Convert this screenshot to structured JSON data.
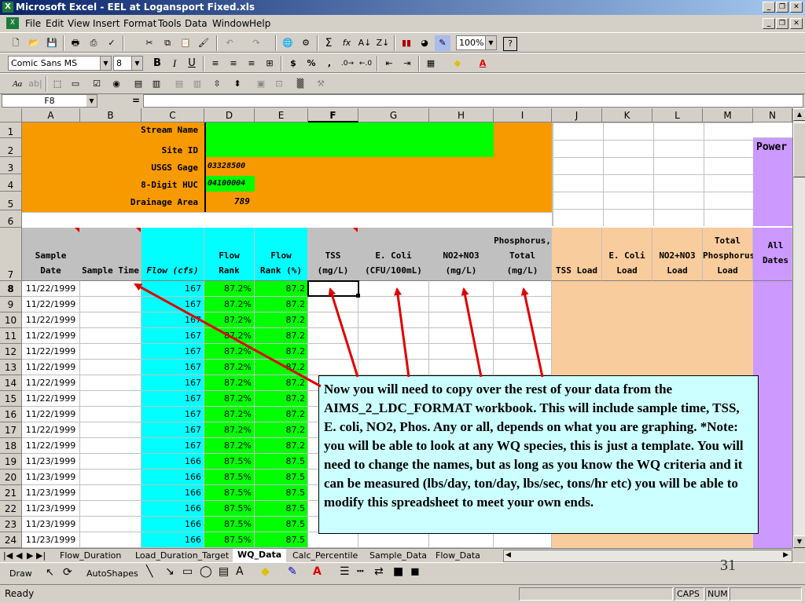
{
  "window": {
    "title": "Microsoft Excel - EEL at Logansport Fixed.xls"
  },
  "menu": [
    "File",
    "Edit",
    "View",
    "Insert",
    "Format",
    "Tools",
    "Data",
    "Window",
    "Help"
  ],
  "toolbar": {
    "zoom": "100%",
    "font": "Comic Sans MS",
    "size": "8"
  },
  "formula": {
    "namebox": "F8",
    "eq": "="
  },
  "columns": [
    "A",
    "B",
    "C",
    "D",
    "E",
    "F",
    "G",
    "H",
    "I",
    "J",
    "K",
    "L",
    "M",
    "N"
  ],
  "labels": {
    "stream_name": "Stream Name",
    "site_id": "Site ID",
    "usgs_gage": "USGS Gage",
    "huc": "8-Digit HUC",
    "drainage": "Drainage Area",
    "usgs_gage_val": "03328500",
    "huc_val": "04100004",
    "drainage_val": "789",
    "power": "Power"
  },
  "headers": {
    "sample_date": [
      "Sample",
      "Date"
    ],
    "sample_time": "Sample Time",
    "flow": "Flow (cfs)",
    "flow_rank": [
      "Flow",
      "Rank"
    ],
    "flow_rank_pct": [
      "Flow",
      "Rank (%)"
    ],
    "tss": [
      "TSS",
      "(mg/L)"
    ],
    "ecoli": [
      "E. Coli",
      "(CFU/100mL)"
    ],
    "no2": [
      "NO2+NO3",
      "(mg/L)"
    ],
    "phos": [
      "Phosphorus,",
      "Total",
      "(mg/L)"
    ],
    "tss_load": "TSS Load",
    "ecoli_load": [
      "E. Coli",
      "Load"
    ],
    "no2_load": [
      "NO2+NO3",
      "Load"
    ],
    "phos_load": [
      "Total",
      "Phosphorus",
      "Load"
    ],
    "all_dates": "All Dates"
  },
  "rows": [
    {
      "n": "8",
      "date": "11/22/1999",
      "flow": "167",
      "rank": "87.2%",
      "pct": "87.2"
    },
    {
      "n": "9",
      "date": "11/22/1999",
      "flow": "167",
      "rank": "87.2%",
      "pct": "87.2"
    },
    {
      "n": "10",
      "date": "11/22/1999",
      "flow": "167",
      "rank": "87.2%",
      "pct": "87.2"
    },
    {
      "n": "11",
      "date": "11/22/1999",
      "flow": "167",
      "rank": "87.2%",
      "pct": "87.2"
    },
    {
      "n": "12",
      "date": "11/22/1999",
      "flow": "167",
      "rank": "87.2%",
      "pct": "87.2"
    },
    {
      "n": "13",
      "date": "11/22/1999",
      "flow": "167",
      "rank": "87.2%",
      "pct": "87.2"
    },
    {
      "n": "14",
      "date": "11/22/1999",
      "flow": "167",
      "rank": "87.2%",
      "pct": "87.2"
    },
    {
      "n": "15",
      "date": "11/22/1999",
      "flow": "167",
      "rank": "87.2%",
      "pct": "87.2"
    },
    {
      "n": "16",
      "date": "11/22/1999",
      "flow": "167",
      "rank": "87.2%",
      "pct": "87.2"
    },
    {
      "n": "17",
      "date": "11/22/1999",
      "flow": "167",
      "rank": "87.2%",
      "pct": "87.2"
    },
    {
      "n": "18",
      "date": "11/22/1999",
      "flow": "167",
      "rank": "87.2%",
      "pct": "87.2"
    },
    {
      "n": "19",
      "date": "11/23/1999",
      "flow": "166",
      "rank": "87.5%",
      "pct": "87.5"
    },
    {
      "n": "20",
      "date": "11/23/1999",
      "flow": "166",
      "rank": "87.5%",
      "pct": "87.5"
    },
    {
      "n": "21",
      "date": "11/23/1999",
      "flow": "166",
      "rank": "87.5%",
      "pct": "87.5"
    },
    {
      "n": "22",
      "date": "11/23/1999",
      "flow": "166",
      "rank": "87.5%",
      "pct": "87.5"
    },
    {
      "n": "23",
      "date": "11/23/1999",
      "flow": "166",
      "rank": "87.5%",
      "pct": "87.5"
    },
    {
      "n": "24",
      "date": "11/23/1999",
      "flow": "166",
      "rank": "87.5%",
      "pct": "87.5"
    }
  ],
  "sheets": [
    "Flow_Duration",
    "Load_Duration_Target",
    "WQ_Data",
    "Calc_Percentile",
    "Sample_Data",
    "Flow_Data"
  ],
  "draw": {
    "draw": "Draw",
    "autoshapes": "AutoShapes"
  },
  "status": {
    "ready": "Ready",
    "caps": "CAPS",
    "num": "NUM"
  },
  "slide_number": "31",
  "callout": "Now you will need to copy over the rest of your data from the AIMS_2_LDC_FORMAT workbook.  This will include sample time, TSS, E. coli, NO2, Phos.  Any or all, depends on what you are graphing. *Note: you will be able to look at any WQ species, this is just a template.  You will need to change the names, but as long as you know the WQ criteria and it can be measured (lbs/day, ton/day, lbs/sec, tons/hr etc) you will be able to modify this spreadsheet to meet your own ends.",
  "colors": {
    "orange": "#f79a00",
    "green": "#00ff00",
    "cyan": "#00ffff",
    "peach": "#f9cc9d",
    "purple": "#cc99ff",
    "callout": "#ccffff",
    "arrow": "#e00000"
  }
}
